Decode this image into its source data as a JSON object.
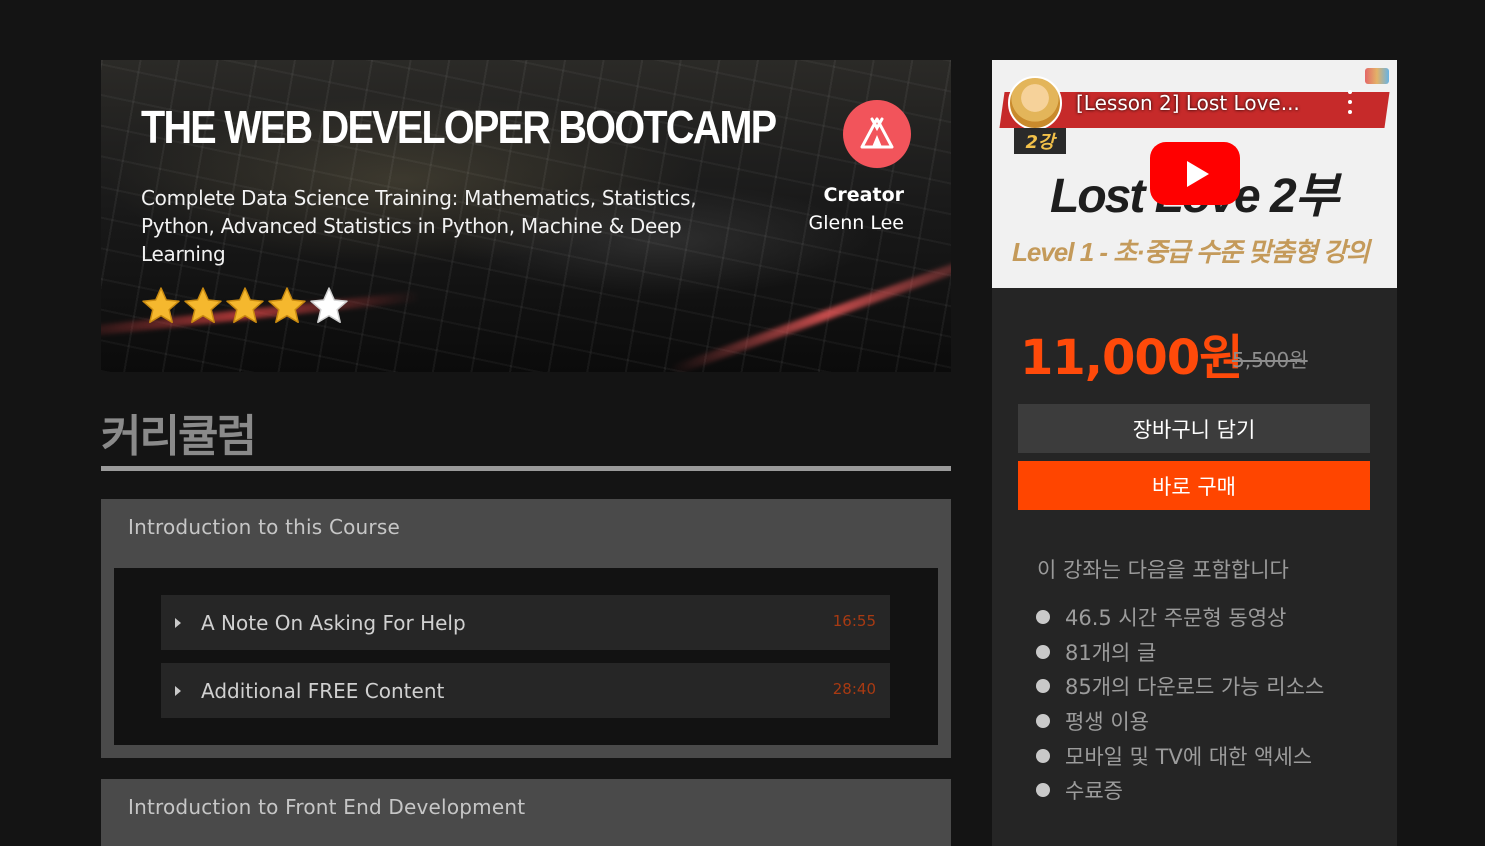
{
  "hero": {
    "title": "The Web Developer Bootcamp",
    "subtitle": "Complete Data Science Training: Mathematics, Statistics, Python, Advanced Statistics in Python, Machine & Deep Learning",
    "rating": 4,
    "rating_max": 5,
    "creator_label": "Creator",
    "creator_name": "Glenn Lee",
    "creator_logo_icon": "tent-icon"
  },
  "curriculum": {
    "title": "커리큘럼",
    "sections": [
      {
        "title": "Introduction to this Course",
        "lectures": [
          {
            "title": "A Note On Asking For Help",
            "duration": "16:55"
          },
          {
            "title": "Additional FREE Content",
            "duration": "28:40"
          }
        ]
      },
      {
        "title": "Introduction to Front End Development",
        "lectures": []
      }
    ]
  },
  "sidebar": {
    "video": {
      "title": "[Lesson 2] Lost Love...",
      "tag": "2강",
      "headline": "Lost Love 2부",
      "level_text": "Level 1 - 초·중급 수준 맞춤형 강의"
    },
    "price": "11,000원",
    "price_original": "5,500원",
    "cart_button": "장바구니 담기",
    "buy_button": "바로 구매",
    "includes_title": "이 강좌는 다음을 포함합니다",
    "includes": [
      "46.5 시간 주문형 동영상",
      "81개의 글",
      "85개의 다운로드 가능 리소스",
      "평생 이용",
      "모바일 및 TV에 대한 액세스",
      "수료증"
    ]
  },
  "colors": {
    "accent": "#ff4500",
    "price": "#ff4a0a",
    "creator_logo": "#f2545b",
    "duration": "#a83a12",
    "star": "#f5b82e"
  }
}
